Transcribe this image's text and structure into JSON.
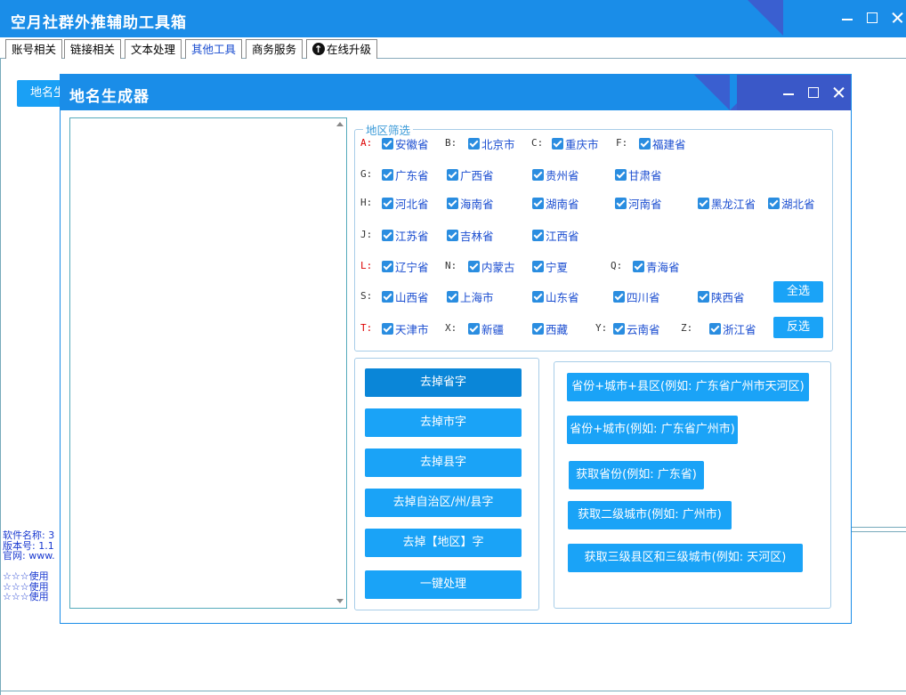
{
  "app": {
    "title": "空月社群外推辅助工具箱",
    "tabs": [
      "账号相关",
      "链接相关",
      "文本处理",
      "其他工具",
      "商务服务",
      "在线升级"
    ],
    "active_tab": "其他工具",
    "bg_button_label": "地名生",
    "info_lines": [
      "软件名称: 3",
      "版本号: 1.1",
      "官网: www.",
      "",
      "☆☆☆使用",
      "☆☆☆使用",
      "☆☆☆使用"
    ]
  },
  "dialog": {
    "title": "地名生成器",
    "region_legend": "地区筛选",
    "select_all": "全选",
    "invert": "反选",
    "letters": {
      "A": "A:",
      "B": "B:",
      "C": "C:",
      "F": "F:",
      "G": "G:",
      "H": "H:",
      "J": "J:",
      "L": "L:",
      "N": "N:",
      "Q": "Q:",
      "S": "S:",
      "T": "T:",
      "X": "X:",
      "Y": "Y:",
      "Z": "Z:"
    },
    "provinces": {
      "anhui": "安徽省",
      "beijing": "北京市",
      "chongqing": "重庆市",
      "fujian": "福建省",
      "guangdong": "广东省",
      "guangxi": "广西省",
      "guizhou": "贵州省",
      "gansu": "甘肃省",
      "hebei": "河北省",
      "hainan": "海南省",
      "hunan": "湖南省",
      "henan": "河南省",
      "heilongjiang": "黑龙江省",
      "hubei": "湖北省",
      "jiangsu": "江苏省",
      "jilin": "吉林省",
      "jiangxi": "江西省",
      "liaoning": "辽宁省",
      "neimenggu": "内蒙古",
      "ningxia": "宁夏",
      "qinghai": "青海省",
      "shanxi": "山西省",
      "shanghai": "上海市",
      "shandong": "山东省",
      "sichuan": "四川省",
      "shaanxi": "陕西省",
      "tianjin": "天津市",
      "xinjiang": "新疆",
      "xizang": "西藏",
      "yunnan": "云南省",
      "zhejiang": "浙江省"
    },
    "ops": [
      "去掉省字",
      "去掉市字",
      "去掉县字",
      "去掉自治区/州/县字",
      "去掉【地区】字",
      "一键处理"
    ],
    "generators": [
      "省份+城市+县区(例如: 广东省广州市天河区)",
      "省份+城市(例如: 广东省广州市)",
      "获取省份(例如: 广东省)",
      "获取二级城市(例如: 广州市)",
      "获取三级县区和三级城市(例如: 天河区)"
    ]
  }
}
